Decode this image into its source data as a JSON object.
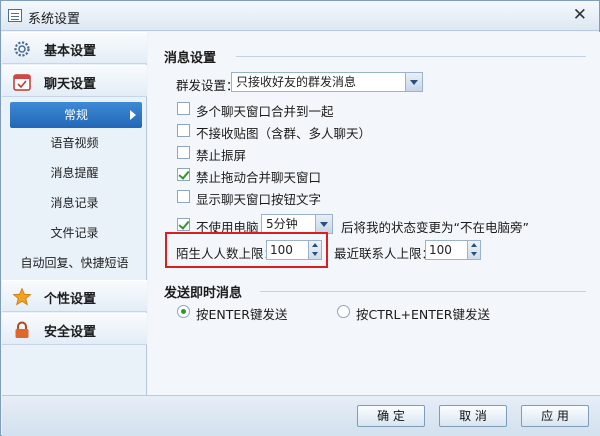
{
  "window": {
    "title": "系统设置"
  },
  "sidebar": {
    "categories": [
      {
        "label": "基本设置",
        "icon": "gear-icon"
      },
      {
        "label": "聊天设置",
        "icon": "chat-calendar-icon"
      },
      {
        "label": "个性设置",
        "icon": "star-icon"
      },
      {
        "label": "安全设置",
        "icon": "lock-icon"
      }
    ],
    "chat_items": [
      "常规",
      "语音视频",
      "消息提醒",
      "消息记录",
      "文件记录",
      "自动回复、快捷短语"
    ]
  },
  "main": {
    "message_section_title": "消息设置",
    "group_label": "群发设置：",
    "group_value": "只接收好友的群发消息",
    "options": [
      {
        "label": "多个聊天窗口合并到一起",
        "checked": false
      },
      {
        "label": "不接收贴图（含群、多人聊天）",
        "checked": false
      },
      {
        "label": "禁止振屏",
        "checked": false
      },
      {
        "label": "禁止拖动合并聊天窗口",
        "checked": true
      },
      {
        "label": "显示聊天窗口按钮文字",
        "checked": false
      }
    ],
    "idle": {
      "label": "不使用电脑",
      "checked": true,
      "value": "5分钟",
      "suffix": "后将我的状态变更为“不在电脑旁”"
    },
    "stranger_label": "陌生人人数上限：",
    "stranger_value": "100",
    "recent_label": "最近联系人上限：",
    "recent_value": "100",
    "send_section_title": "发送即时消息",
    "send_options": [
      {
        "label": "按ENTER键发送",
        "selected": true
      },
      {
        "label": "按CTRL+ENTER键发送",
        "selected": false
      }
    ]
  },
  "footer": {
    "ok": "确 定",
    "cancel": "取 消",
    "apply": "应 用"
  },
  "colors": {
    "accent": "#2367b5",
    "highlight": "#d92020",
    "check": "#2a9a2a"
  }
}
